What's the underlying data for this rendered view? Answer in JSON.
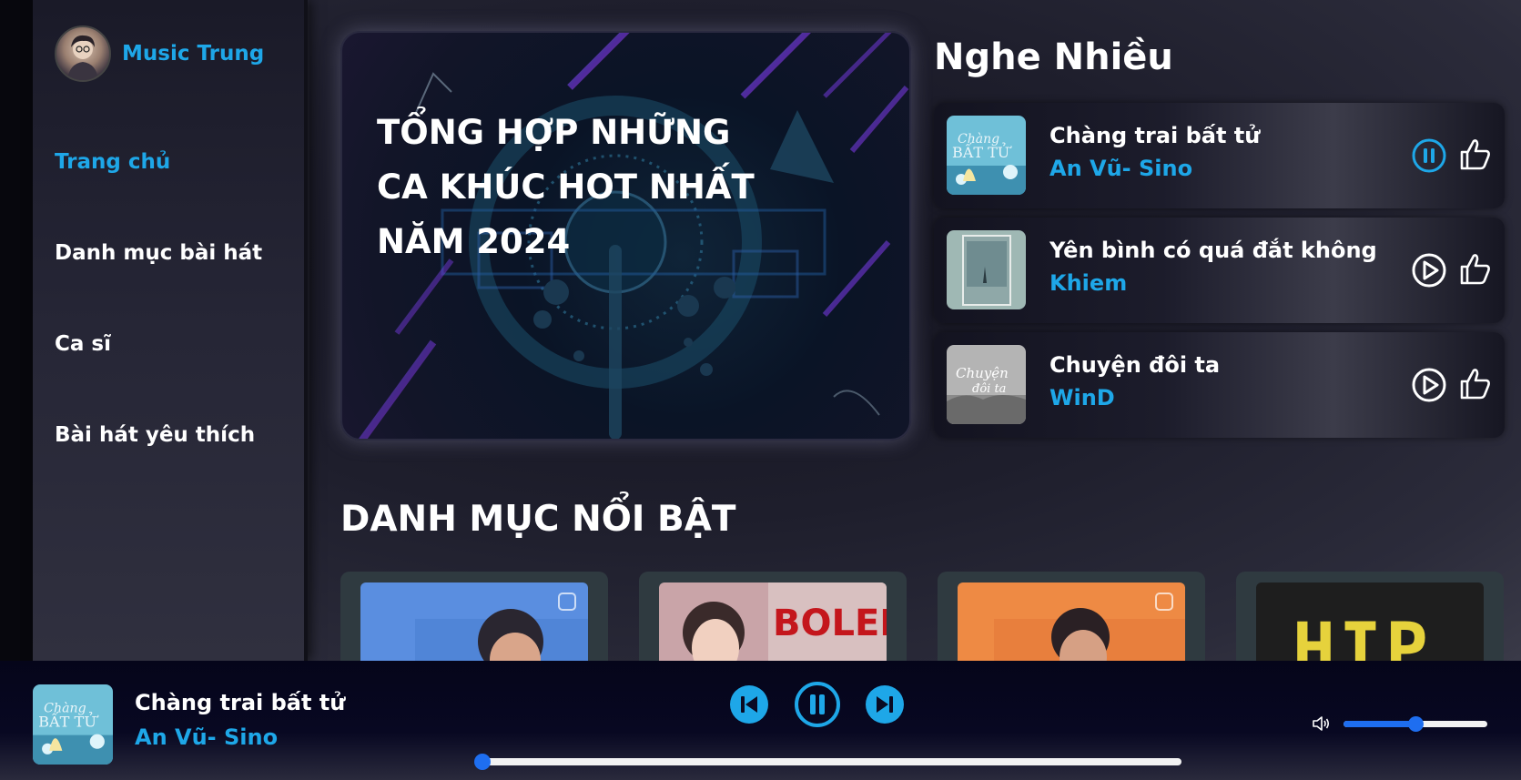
{
  "sidebar": {
    "brand_name": "Music Trung",
    "items": [
      {
        "label": "Trang chủ",
        "active": true
      },
      {
        "label": "Danh mục bài hát",
        "active": false
      },
      {
        "label": "Ca sĩ",
        "active": false
      },
      {
        "label": "Bài hát yêu thích",
        "active": false
      }
    ]
  },
  "banner": {
    "title_line1": "TỔNG HỢP NHỮNG",
    "title_line2": "CA KHÚC HOT NHẤT",
    "title_line3": "NĂM 2024"
  },
  "top_songs": {
    "heading": "Nghe Nhiều",
    "items": [
      {
        "title": "Chàng trai bất tử",
        "artist": "An Vũ- Sino",
        "state": "playing",
        "icon": "pause-circle-icon"
      },
      {
        "title": "Yên bình có quá đắt không",
        "artist": "Khiem",
        "state": "paused",
        "icon": "play-circle-icon"
      },
      {
        "title": "Chuyện đôi ta",
        "artist": "WinD",
        "state": "paused",
        "icon": "play-circle-icon"
      }
    ],
    "like_icon": "thumbs-up-icon"
  },
  "featured": {
    "heading": "DANH MỤC NỔI BẬT",
    "cards": [
      {
        "name": "card-1",
        "art_text": ""
      },
      {
        "name": "card-2",
        "art_text": "BOLERO"
      },
      {
        "name": "card-3",
        "art_text": ""
      },
      {
        "name": "card-4",
        "art_text": "HIP"
      }
    ]
  },
  "player": {
    "title": "Chàng trai bất tử",
    "artist": "An Vũ- Sino",
    "progress_fraction": 0.01,
    "volume_fraction": 0.5,
    "icons": {
      "prev": "skip-back-icon",
      "pause": "pause-icon",
      "next": "skip-forward-icon",
      "volume": "volume-icon"
    }
  },
  "colors": {
    "accent": "#1ea7e8",
    "slider": "#1e6ef0"
  }
}
